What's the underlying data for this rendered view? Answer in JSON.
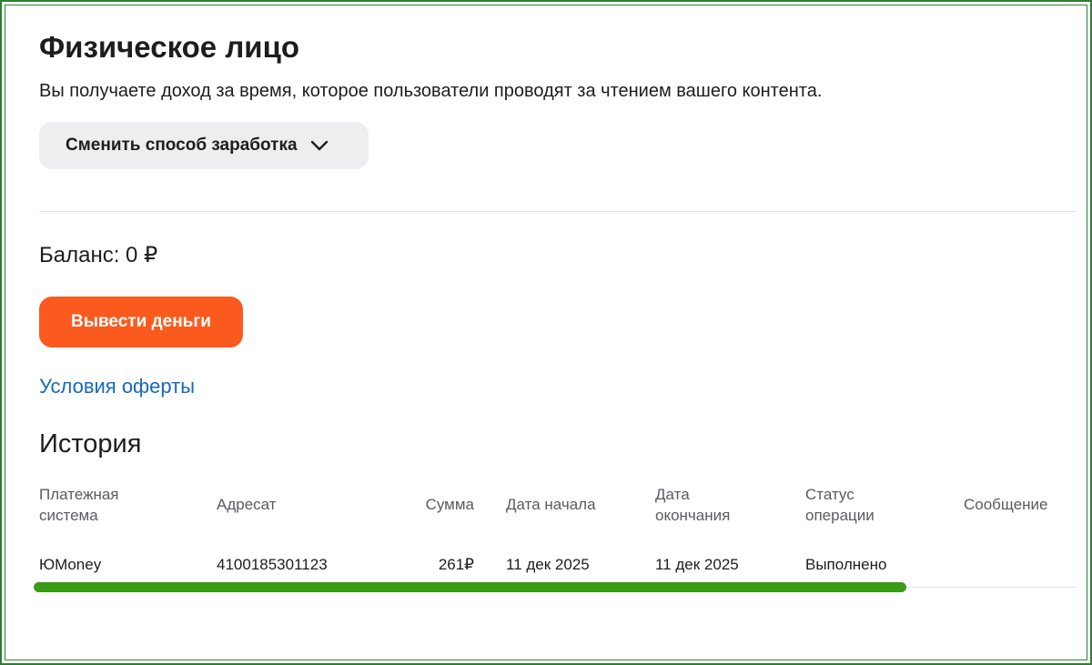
{
  "header": {
    "title": "Физическое лицо",
    "description": "Вы получаете доход за время, которое пользователи проводят за чтением вашего контента.",
    "change_method_label": "Сменить способ заработка",
    "change_method_icon": "chevron-down-icon"
  },
  "balance": {
    "label": "Баланс: 0 ₽"
  },
  "actions": {
    "withdraw_label": "Вывести деньги",
    "withdraw_color": "#fb5a1e",
    "offer_link_label": "Условия оферты",
    "link_color": "#1769b9"
  },
  "history": {
    "title": "История",
    "columns": {
      "payment_system": [
        "Платежная",
        "система"
      ],
      "recipient": "Адресат",
      "amount": "Сумма",
      "start_date": "Дата начала",
      "end_date": [
        "Дата",
        "окончания"
      ],
      "status": [
        "Статус",
        "операции"
      ],
      "message": "Сообщение"
    },
    "rows": [
      {
        "payment_system": "ЮMoney",
        "recipient": "4100185301123",
        "amount": "261₽",
        "start_date": "11 дек 2025",
        "end_date": "11 дек 2025",
        "status": "Выполнено",
        "message": ""
      }
    ],
    "highlight_color": "#3a9b14"
  }
}
